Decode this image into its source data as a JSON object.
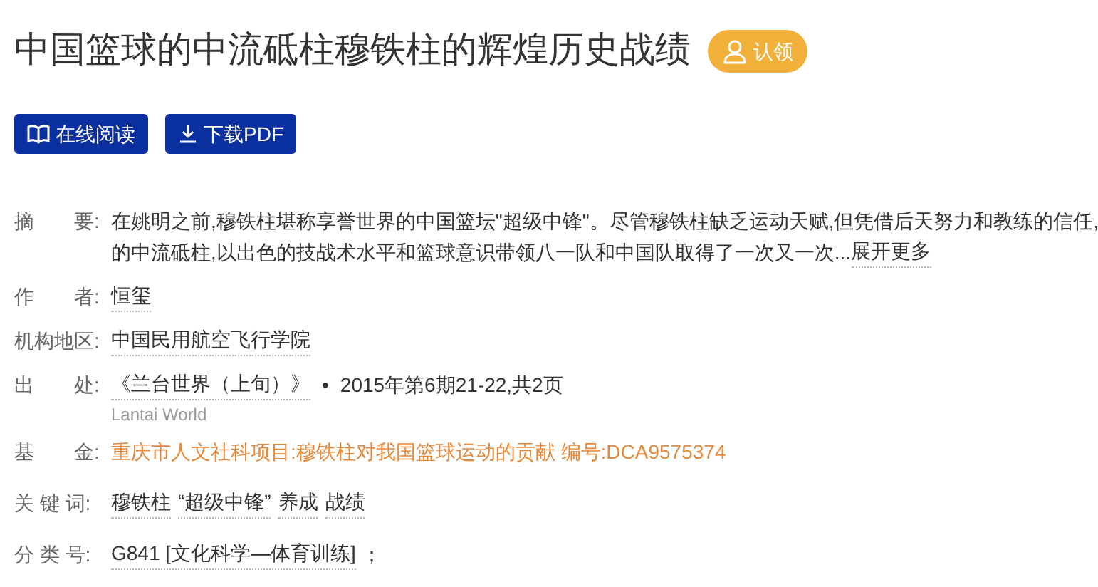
{
  "title": "中国篮球的中流砥柱穆铁柱的辉煌历史战绩",
  "claim_badge": {
    "label": "认领"
  },
  "buttons": [
    {
      "kind": "read",
      "label": "在线阅读"
    },
    {
      "kind": "download",
      "label": "下载PDF"
    }
  ],
  "abstract": {
    "label": "摘　　要:",
    "lines": [
      "在姚明之前,穆铁柱堪称享誉世界的中国篮坛\"超级中锋\"。尽管穆铁柱缺乏运动天赋,但凭借后天努力和教练的信任,",
      "的中流砥柱,以出色的技战术水平和篮球意识带领八一队和中国队取得了一次又一次..."
    ],
    "more": "展开更多"
  },
  "author": {
    "label": "作　　者:",
    "value": "恒玺"
  },
  "institution": {
    "label": "机构地区:",
    "value": "中国民用航空飞行学院"
  },
  "source": {
    "label": "出　　处:",
    "journal": "《兰台世界（上旬）》",
    "separator": "•",
    "issue": "2015年第6期21-22,共2页",
    "english": "Lantai World"
  },
  "fund": {
    "label": "基　　金:",
    "value": "重庆市人文社科项目:穆铁柱对我国篮球运动的贡献 编号:DCA9575374"
  },
  "keywords": {
    "label": "关 键 词:",
    "items": [
      "穆铁柱",
      "“超级中锋”",
      "养成",
      "战绩"
    ]
  },
  "classification": {
    "label": "分 类 号:",
    "value": "G841 [文化科学—体育训练]",
    "suffix": "；"
  }
}
